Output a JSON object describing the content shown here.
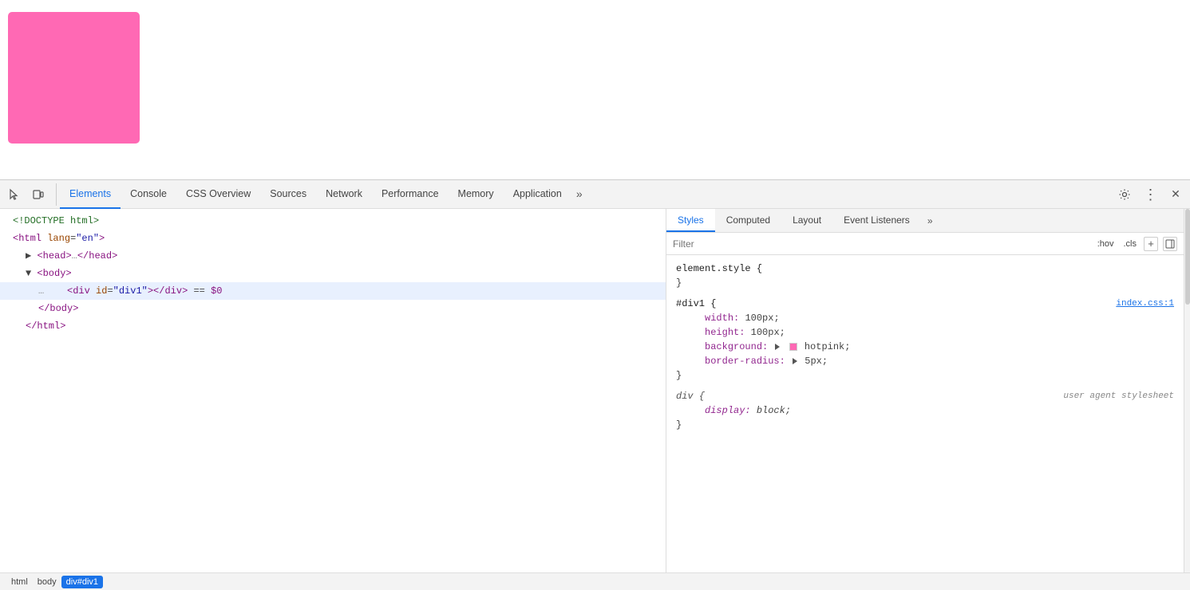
{
  "page": {
    "pink_box_label": "pink box"
  },
  "devtools": {
    "toolbar": {
      "cursor_icon": "⬡",
      "device_icon": "▭",
      "more_icon": "»"
    },
    "tabs": [
      {
        "id": "elements",
        "label": "Elements",
        "active": true
      },
      {
        "id": "console",
        "label": "Console",
        "active": false
      },
      {
        "id": "css-overview",
        "label": "CSS Overview",
        "active": false
      },
      {
        "id": "sources",
        "label": "Sources",
        "active": false
      },
      {
        "id": "network",
        "label": "Network",
        "active": false
      },
      {
        "id": "performance",
        "label": "Performance",
        "active": false
      },
      {
        "id": "memory",
        "label": "Memory",
        "active": false
      },
      {
        "id": "application",
        "label": "Application",
        "active": false
      }
    ],
    "toolbar_right": {
      "settings_icon": "⚙",
      "more_icon": "⋮",
      "close_icon": "✕"
    }
  },
  "elements_panel": {
    "lines": [
      {
        "indent": 0,
        "content": "<!DOCTYPE html>",
        "type": "comment"
      },
      {
        "indent": 0,
        "content": "<html lang=\"en\">",
        "type": "tag"
      },
      {
        "indent": 1,
        "content": "▶ <head>…</head>",
        "type": "tag"
      },
      {
        "indent": 1,
        "content": "▼ <body>",
        "type": "tag"
      },
      {
        "indent": 2,
        "content": "<div id=\"div1\"></div>  ==  $0",
        "type": "selected"
      },
      {
        "indent": 2,
        "content": "</body>",
        "type": "tag"
      },
      {
        "indent": 1,
        "content": "</html>",
        "type": "tag"
      }
    ]
  },
  "styles_panel": {
    "tabs": [
      {
        "id": "styles",
        "label": "Styles",
        "active": true
      },
      {
        "id": "computed",
        "label": "Computed",
        "active": false
      },
      {
        "id": "layout",
        "label": "Layout",
        "active": false
      },
      {
        "id": "event-listeners",
        "label": "Event Listeners",
        "active": false
      }
    ],
    "filter": {
      "placeholder": "Filter",
      "hov_label": ":hov",
      "cls_label": ".cls"
    },
    "rules": [
      {
        "selector": "element.style {",
        "italic": false,
        "properties": [],
        "close": "}",
        "source": ""
      },
      {
        "selector": "#div1 {",
        "italic": false,
        "properties": [
          {
            "prop": "width:",
            "value": " 100px;",
            "italic": false
          },
          {
            "prop": "height:",
            "value": " 100px;",
            "italic": false
          },
          {
            "prop": "background:",
            "value": " hotpink;",
            "italic": false,
            "swatch": true,
            "triangle": true
          },
          {
            "prop": "border-radius:",
            "value": " 5px;",
            "italic": false,
            "triangle": true
          }
        ],
        "close": "}",
        "source": "index.css:1"
      },
      {
        "selector": "div {",
        "italic": true,
        "properties": [
          {
            "prop": "display:",
            "value": " block;",
            "italic": true
          }
        ],
        "close": "}",
        "source": "user agent stylesheet",
        "source_italic": true
      }
    ]
  },
  "breadcrumb": {
    "items": [
      {
        "label": "html",
        "selected": false
      },
      {
        "label": "body",
        "selected": false
      },
      {
        "label": "div#div1",
        "selected": true
      }
    ]
  }
}
